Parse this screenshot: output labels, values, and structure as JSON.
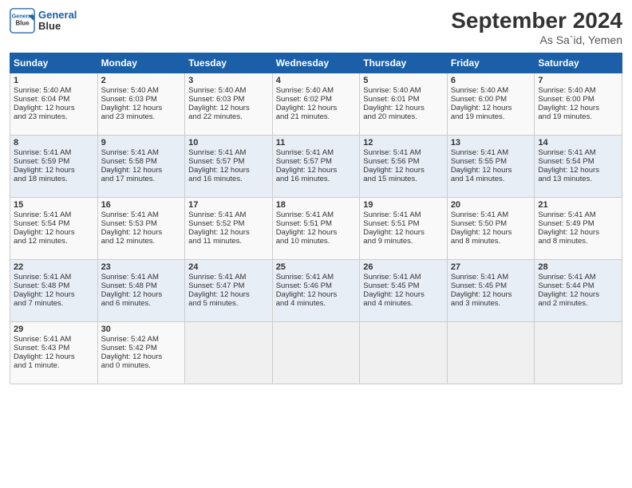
{
  "header": {
    "logo_line1": "General",
    "logo_line2": "Blue",
    "month": "September 2024",
    "location": "As Sa`id, Yemen"
  },
  "days_of_week": [
    "Sunday",
    "Monday",
    "Tuesday",
    "Wednesday",
    "Thursday",
    "Friday",
    "Saturday"
  ],
  "weeks": [
    [
      {
        "day": 1,
        "lines": [
          "Sunrise: 5:40 AM",
          "Sunset: 6:04 PM",
          "Daylight: 12 hours",
          "and 23 minutes."
        ]
      },
      {
        "day": 2,
        "lines": [
          "Sunrise: 5:40 AM",
          "Sunset: 6:03 PM",
          "Daylight: 12 hours",
          "and 23 minutes."
        ]
      },
      {
        "day": 3,
        "lines": [
          "Sunrise: 5:40 AM",
          "Sunset: 6:03 PM",
          "Daylight: 12 hours",
          "and 22 minutes."
        ]
      },
      {
        "day": 4,
        "lines": [
          "Sunrise: 5:40 AM",
          "Sunset: 6:02 PM",
          "Daylight: 12 hours",
          "and 21 minutes."
        ]
      },
      {
        "day": 5,
        "lines": [
          "Sunrise: 5:40 AM",
          "Sunset: 6:01 PM",
          "Daylight: 12 hours",
          "and 20 minutes."
        ]
      },
      {
        "day": 6,
        "lines": [
          "Sunrise: 5:40 AM",
          "Sunset: 6:00 PM",
          "Daylight: 12 hours",
          "and 19 minutes."
        ]
      },
      {
        "day": 7,
        "lines": [
          "Sunrise: 5:40 AM",
          "Sunset: 6:00 PM",
          "Daylight: 12 hours",
          "and 19 minutes."
        ]
      }
    ],
    [
      {
        "day": 8,
        "lines": [
          "Sunrise: 5:41 AM",
          "Sunset: 5:59 PM",
          "Daylight: 12 hours",
          "and 18 minutes."
        ]
      },
      {
        "day": 9,
        "lines": [
          "Sunrise: 5:41 AM",
          "Sunset: 5:58 PM",
          "Daylight: 12 hours",
          "and 17 minutes."
        ]
      },
      {
        "day": 10,
        "lines": [
          "Sunrise: 5:41 AM",
          "Sunset: 5:57 PM",
          "Daylight: 12 hours",
          "and 16 minutes."
        ]
      },
      {
        "day": 11,
        "lines": [
          "Sunrise: 5:41 AM",
          "Sunset: 5:57 PM",
          "Daylight: 12 hours",
          "and 16 minutes."
        ]
      },
      {
        "day": 12,
        "lines": [
          "Sunrise: 5:41 AM",
          "Sunset: 5:56 PM",
          "Daylight: 12 hours",
          "and 15 minutes."
        ]
      },
      {
        "day": 13,
        "lines": [
          "Sunrise: 5:41 AM",
          "Sunset: 5:55 PM",
          "Daylight: 12 hours",
          "and 14 minutes."
        ]
      },
      {
        "day": 14,
        "lines": [
          "Sunrise: 5:41 AM",
          "Sunset: 5:54 PM",
          "Daylight: 12 hours",
          "and 13 minutes."
        ]
      }
    ],
    [
      {
        "day": 15,
        "lines": [
          "Sunrise: 5:41 AM",
          "Sunset: 5:54 PM",
          "Daylight: 12 hours",
          "and 12 minutes."
        ]
      },
      {
        "day": 16,
        "lines": [
          "Sunrise: 5:41 AM",
          "Sunset: 5:53 PM",
          "Daylight: 12 hours",
          "and 12 minutes."
        ]
      },
      {
        "day": 17,
        "lines": [
          "Sunrise: 5:41 AM",
          "Sunset: 5:52 PM",
          "Daylight: 12 hours",
          "and 11 minutes."
        ]
      },
      {
        "day": 18,
        "lines": [
          "Sunrise: 5:41 AM",
          "Sunset: 5:51 PM",
          "Daylight: 12 hours",
          "and 10 minutes."
        ]
      },
      {
        "day": 19,
        "lines": [
          "Sunrise: 5:41 AM",
          "Sunset: 5:51 PM",
          "Daylight: 12 hours",
          "and 9 minutes."
        ]
      },
      {
        "day": 20,
        "lines": [
          "Sunrise: 5:41 AM",
          "Sunset: 5:50 PM",
          "Daylight: 12 hours",
          "and 8 minutes."
        ]
      },
      {
        "day": 21,
        "lines": [
          "Sunrise: 5:41 AM",
          "Sunset: 5:49 PM",
          "Daylight: 12 hours",
          "and 8 minutes."
        ]
      }
    ],
    [
      {
        "day": 22,
        "lines": [
          "Sunrise: 5:41 AM",
          "Sunset: 5:48 PM",
          "Daylight: 12 hours",
          "and 7 minutes."
        ]
      },
      {
        "day": 23,
        "lines": [
          "Sunrise: 5:41 AM",
          "Sunset: 5:48 PM",
          "Daylight: 12 hours",
          "and 6 minutes."
        ]
      },
      {
        "day": 24,
        "lines": [
          "Sunrise: 5:41 AM",
          "Sunset: 5:47 PM",
          "Daylight: 12 hours",
          "and 5 minutes."
        ]
      },
      {
        "day": 25,
        "lines": [
          "Sunrise: 5:41 AM",
          "Sunset: 5:46 PM",
          "Daylight: 12 hours",
          "and 4 minutes."
        ]
      },
      {
        "day": 26,
        "lines": [
          "Sunrise: 5:41 AM",
          "Sunset: 5:45 PM",
          "Daylight: 12 hours",
          "and 4 minutes."
        ]
      },
      {
        "day": 27,
        "lines": [
          "Sunrise: 5:41 AM",
          "Sunset: 5:45 PM",
          "Daylight: 12 hours",
          "and 3 minutes."
        ]
      },
      {
        "day": 28,
        "lines": [
          "Sunrise: 5:41 AM",
          "Sunset: 5:44 PM",
          "Daylight: 12 hours",
          "and 2 minutes."
        ]
      }
    ],
    [
      {
        "day": 29,
        "lines": [
          "Sunrise: 5:41 AM",
          "Sunset: 5:43 PM",
          "Daylight: 12 hours",
          "and 1 minute."
        ]
      },
      {
        "day": 30,
        "lines": [
          "Sunrise: 5:42 AM",
          "Sunset: 5:42 PM",
          "Daylight: 12 hours",
          "and 0 minutes."
        ]
      },
      null,
      null,
      null,
      null,
      null
    ]
  ]
}
